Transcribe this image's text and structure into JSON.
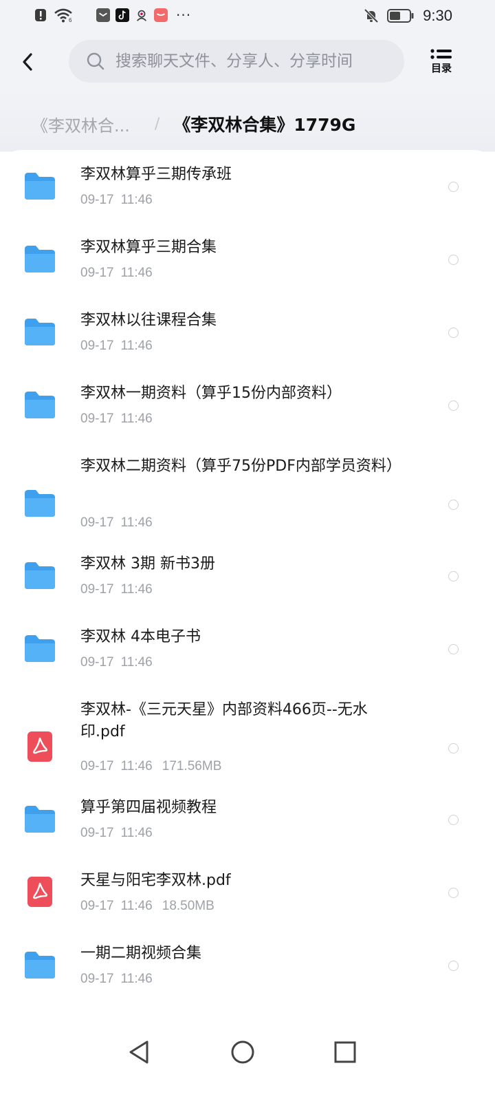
{
  "status_bar": {
    "time": "9:30",
    "more_indicator": "···",
    "left_icons": [
      "alert-icon",
      "wifi-icon",
      "app-notification-icon",
      "tiktok-icon",
      "avatar-notification-icon",
      "red-app-icon"
    ],
    "right_icons": [
      "bell-off-icon",
      "battery-icon"
    ]
  },
  "header": {
    "search_placeholder": "搜索聊天文件、分享人、分享时间",
    "catalog_label": "目录"
  },
  "breadcrumb": {
    "parent": "《李双林合...",
    "separator": "/",
    "current": "《李双林合集》1779G"
  },
  "items": [
    {
      "type": "folder",
      "title": "李双林算乎三期传承班",
      "date": "09-17",
      "time": "11:46",
      "size": ""
    },
    {
      "type": "folder",
      "title": "李双林算乎三期合集",
      "date": "09-17",
      "time": "11:46",
      "size": ""
    },
    {
      "type": "folder",
      "title": "李双林以往课程合集",
      "date": "09-17",
      "time": "11:46",
      "size": ""
    },
    {
      "type": "folder",
      "title": "李双林一期资料（算乎15份内部资料）",
      "date": "09-17",
      "time": "11:46",
      "size": ""
    },
    {
      "type": "folder",
      "title": "李双林二期资料（算乎75份PDF内部学员资料）",
      "date": "09-17",
      "time": "11:46",
      "size": ""
    },
    {
      "type": "folder",
      "title": "李双林 3期 新书3册",
      "date": "09-17",
      "time": "11:46",
      "size": ""
    },
    {
      "type": "folder",
      "title": "李双林 4本电子书",
      "date": "09-17",
      "time": "11:46",
      "size": ""
    },
    {
      "type": "pdf",
      "title": "李双林-《三元天星》内部资料466页--无水印.pdf",
      "date": "09-17",
      "time": "11:46",
      "size": "171.56MB"
    },
    {
      "type": "folder",
      "title": "算乎第四届视频教程",
      "date": "09-17",
      "time": "11:46",
      "size": ""
    },
    {
      "type": "pdf",
      "title": "天星与阳宅李双林.pdf",
      "date": "09-17",
      "time": "11:46",
      "size": "18.50MB"
    },
    {
      "type": "folder",
      "title": "一期二期视频合集",
      "date": "09-17",
      "time": "11:46",
      "size": ""
    }
  ],
  "colors": {
    "folder": "#3fa0ee",
    "pdf": "#ee4d5a",
    "page_bg": "#f1f3f7",
    "search_bg": "#e7e9ef"
  }
}
